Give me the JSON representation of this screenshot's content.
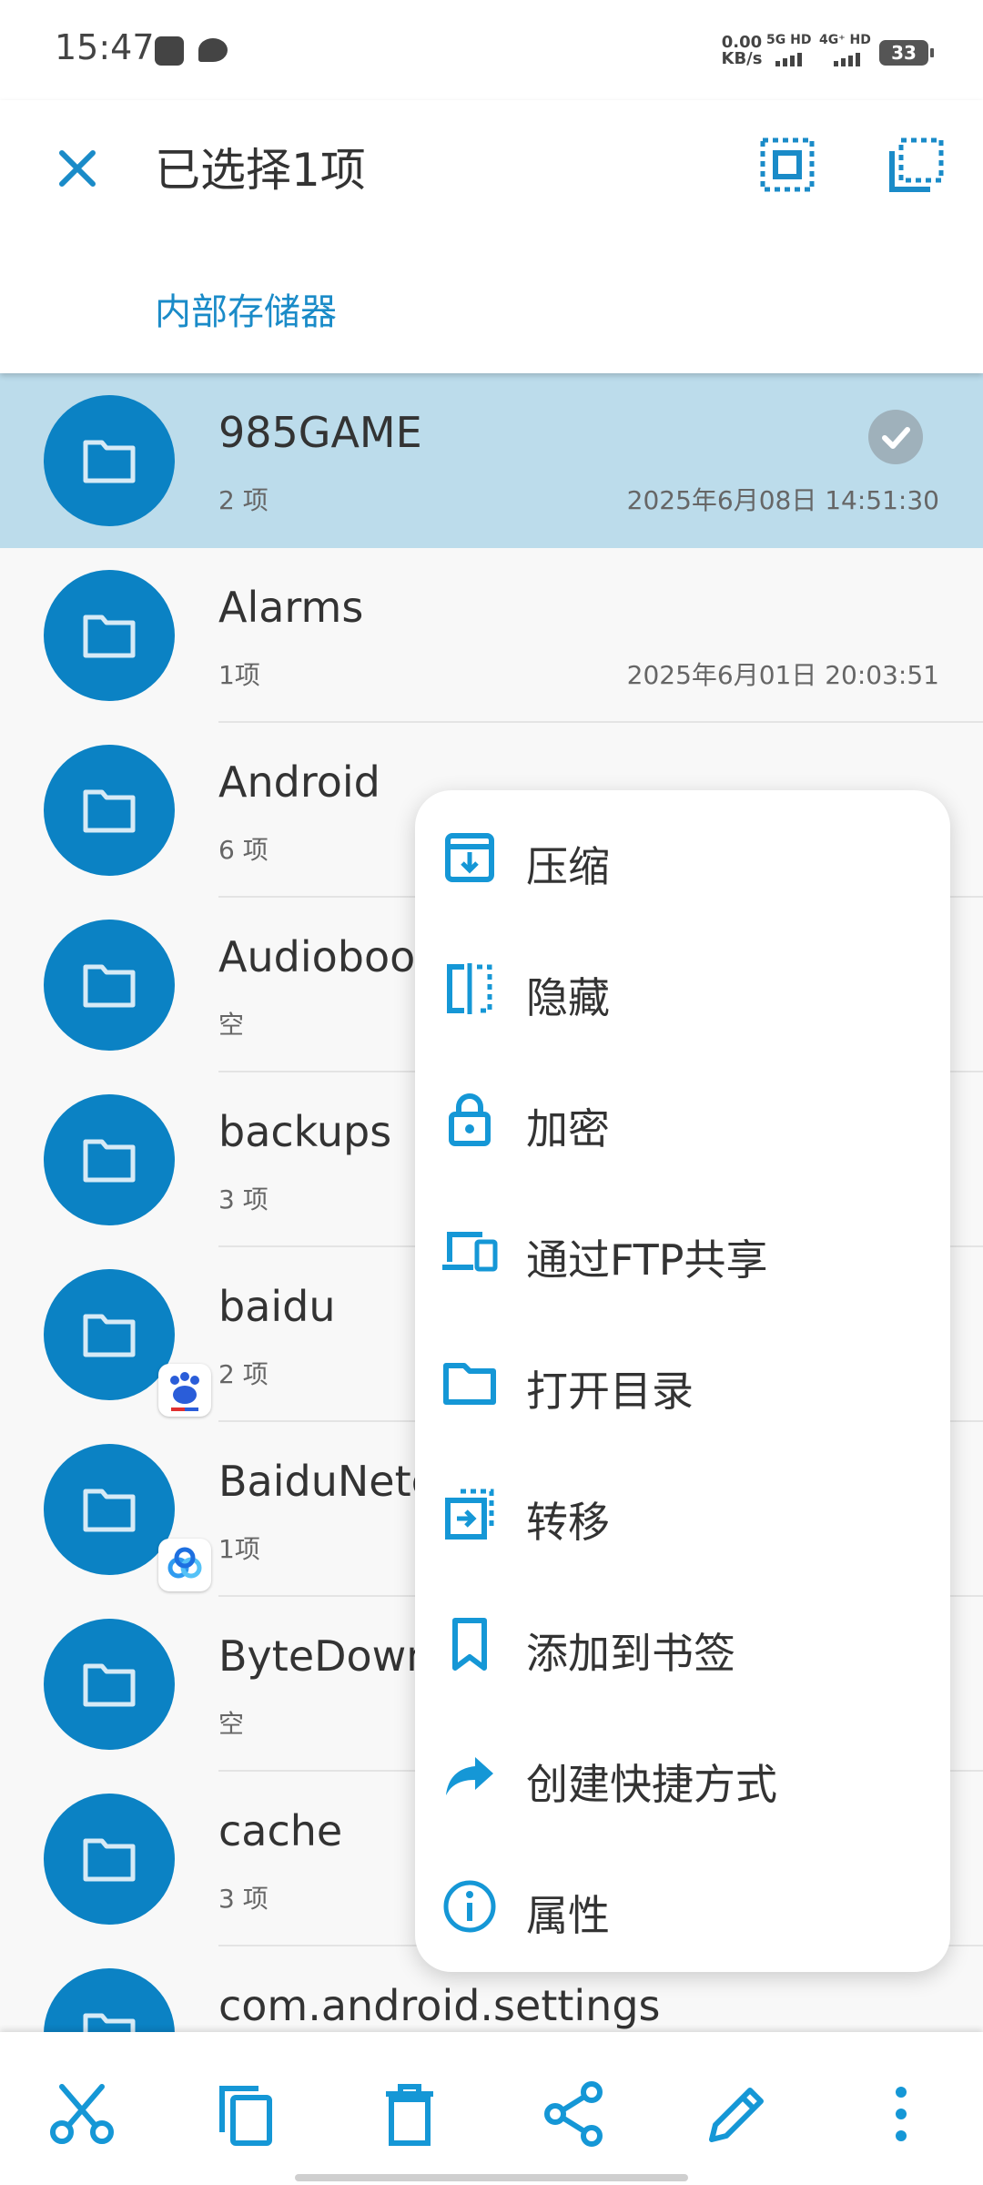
{
  "status_bar": {
    "time": "15:47",
    "net_speed_value": "0.00",
    "net_speed_unit": "KB/s",
    "sim1": "5G HD",
    "sim2": "4G⁺ HD",
    "battery": "33"
  },
  "header": {
    "title": "已选择1项",
    "breadcrumb": "内部存储器"
  },
  "files": [
    {
      "name": "985GAME",
      "count": "2 项",
      "date": "2025年6月08日 14:51:30",
      "selected": true
    },
    {
      "name": "Alarms",
      "count": "1项",
      "date": "2025年6月01日 20:03:51"
    },
    {
      "name": "Android",
      "count": "6 项",
      "date": ""
    },
    {
      "name": "Audioboo",
      "count": "空",
      "date": ""
    },
    {
      "name": "backups",
      "count": "3 项",
      "date": ""
    },
    {
      "name": "baidu",
      "count": "2 项",
      "date": "",
      "badge": "baidu-badge-icon"
    },
    {
      "name": "BaiduNetc",
      "count": "1项",
      "date": "",
      "badge": "baidu-netdisk-badge-icon"
    },
    {
      "name": "ByteDown",
      "count": "空",
      "date": ""
    },
    {
      "name": "cache",
      "count": "3 项",
      "date": ""
    },
    {
      "name": "com.android.settings",
      "count": "",
      "date": ""
    }
  ],
  "menu": {
    "items": [
      {
        "label": "压缩",
        "icon": "archive-icon"
      },
      {
        "label": "隐藏",
        "icon": "hide-icon"
      },
      {
        "label": "加密",
        "icon": "lock-icon"
      },
      {
        "label": "通过FTP共享",
        "icon": "devices-icon"
      },
      {
        "label": "打开目录",
        "icon": "folder-icon"
      },
      {
        "label": "转移",
        "icon": "move-icon"
      },
      {
        "label": "添加到书签",
        "icon": "bookmark-icon"
      },
      {
        "label": "创建快捷方式",
        "icon": "shortcut-icon"
      },
      {
        "label": "属性",
        "icon": "info-icon"
      }
    ]
  },
  "bottom_bar": [
    "cut-icon",
    "copy-icon",
    "delete-icon",
    "share-icon",
    "rename-icon",
    "more-icon"
  ],
  "colors": {
    "accent": "#1a8bc8",
    "folder_circle": "#0b82c4",
    "selected_row": "#bcdceb",
    "icon_blue": "#1597d6"
  }
}
